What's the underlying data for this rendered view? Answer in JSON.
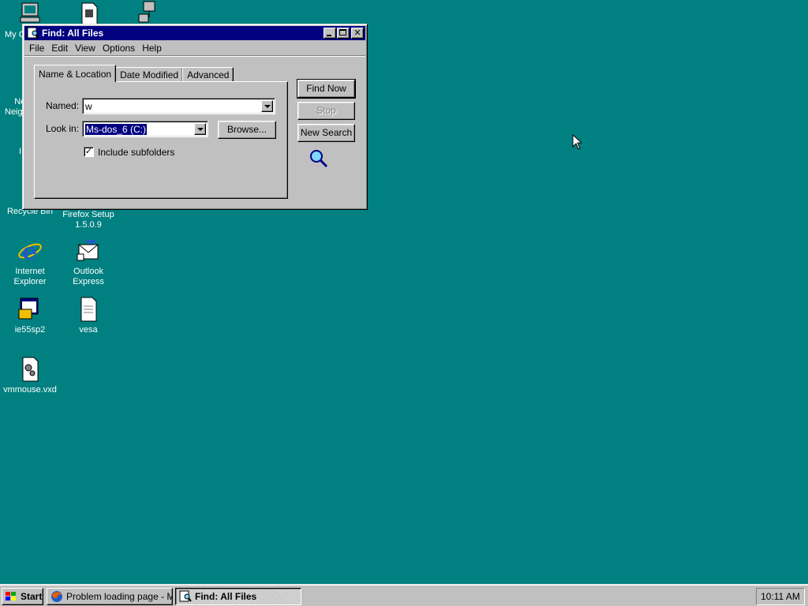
{
  "desktop": {
    "icons": [
      {
        "label": "My C",
        "icon": "my-computer-icon"
      },
      {
        "label": "",
        "icon": "document-icon"
      },
      {
        "label": "",
        "icon": "network-icon"
      },
      {
        "label": "Ne\nNeigh",
        "icon": "network-neighborhood-icon"
      },
      {
        "label": "I",
        "icon": "inbox-icon"
      },
      {
        "label": "Recycle Bin",
        "icon": "recycle-bin-icon"
      },
      {
        "label": "Firefox Setup 1.5.0.9",
        "icon": "setup-icon"
      },
      {
        "label": "Internet Explorer",
        "icon": "internet-explorer-icon"
      },
      {
        "label": "Outlook Express",
        "icon": "outlook-express-icon"
      },
      {
        "label": "ie55sp2",
        "icon": "installer-icon"
      },
      {
        "label": "vesa",
        "icon": "text-file-icon"
      },
      {
        "label": "vmmouse.vxd",
        "icon": "system-file-icon"
      }
    ]
  },
  "window": {
    "title": "Find: All Files",
    "menu": [
      {
        "label": "File"
      },
      {
        "label": "Edit"
      },
      {
        "label": "View"
      },
      {
        "label": "Options"
      },
      {
        "label": "Help"
      }
    ],
    "tabs": [
      "Name & Location",
      "Date Modified",
      "Advanced"
    ],
    "active_tab": "Name & Location",
    "named_label": "Named:",
    "named_value": "w",
    "lookin_label": "Look in:",
    "lookin_value": "Ms-dos_6 (C:)",
    "browse_label": "Browse...",
    "subfolders_label": "Include subfolders",
    "subfolders_checked": true,
    "buttons": {
      "find_now": "Find Now",
      "stop": "Stop",
      "new_search": "New Search"
    }
  },
  "taskbar": {
    "start_label": "Start",
    "tasks": [
      {
        "label": "Problem loading page - Mo...",
        "icon": "firefox-icon"
      },
      {
        "label": "Find: All Files",
        "icon": "find-icon"
      }
    ],
    "clock": "10:11 AM"
  },
  "colors": {
    "desktop": "#008080",
    "titlebar": "#000080",
    "face": "#c0c0c0"
  }
}
